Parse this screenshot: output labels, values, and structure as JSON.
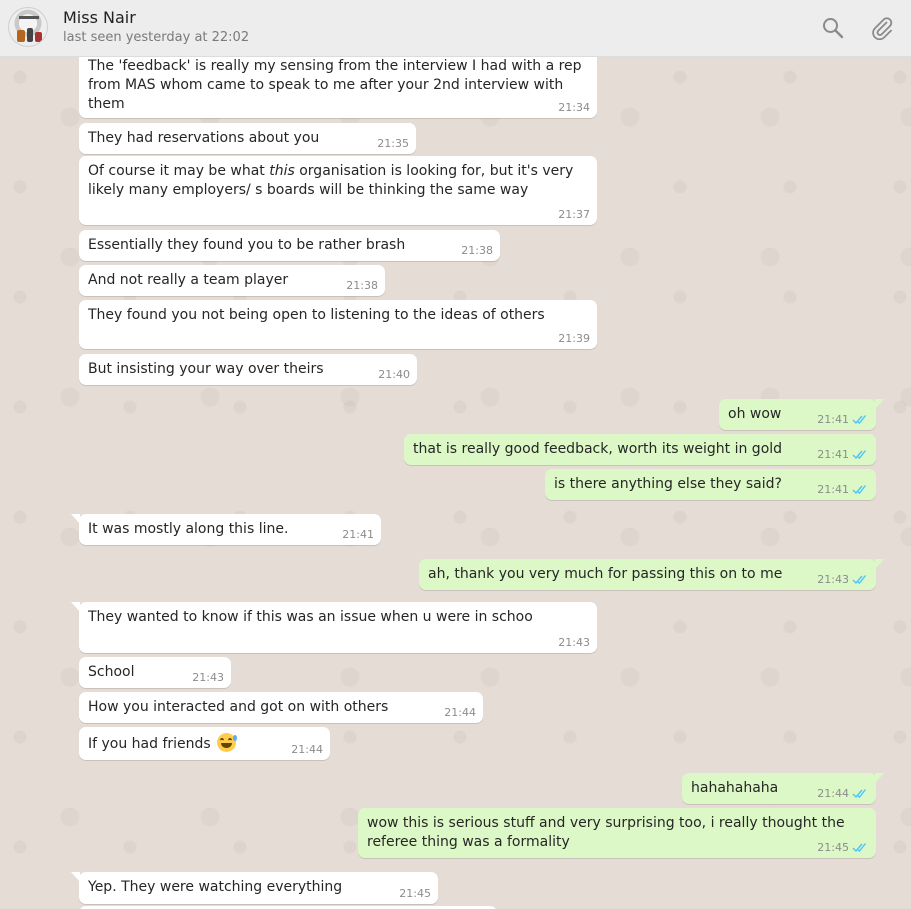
{
  "header": {
    "contact_name": "Miss Nair",
    "last_seen": "last seen yesterday at 22:02",
    "search_icon": "search-icon",
    "attach_icon": "paperclip-icon"
  },
  "colors": {
    "chat_background": "#e5ddd5",
    "incoming_bubble": "#ffffff",
    "outgoing_bubble": "#dcf8c6",
    "read_ticks": "#4fc3f7"
  },
  "messages": [
    {
      "dir": "in",
      "time": "21:34",
      "lines": [
        "The 'feedback' is really my sensing from the interview I had with a rep",
        "from MAS whom came to speak to me after your 2nd interview with",
        "them"
      ]
    },
    {
      "dir": "in",
      "time": "21:35",
      "lines": [
        "They had reservations about you"
      ]
    },
    {
      "dir": "in",
      "time": "21:37",
      "pre": "Of course it may be what ",
      "em": "this",
      "post": " organisation is looking for, but it's very",
      "line2": "likely many employers/ s boards will be thinking the same way"
    },
    {
      "dir": "in",
      "time": "21:38",
      "lines": [
        "Essentially they found you to be rather brash"
      ]
    },
    {
      "dir": "in",
      "time": "21:38",
      "lines": [
        "And not really a team player"
      ]
    },
    {
      "dir": "in",
      "time": "21:39",
      "lines": [
        "They found you not being open to listening to the ideas of others"
      ]
    },
    {
      "dir": "in",
      "time": "21:40",
      "lines": [
        "But insisting your way over theirs"
      ]
    },
    {
      "dir": "out",
      "time": "21:41",
      "status": "read",
      "lines": [
        "oh wow"
      ]
    },
    {
      "dir": "out",
      "time": "21:41",
      "status": "read",
      "lines": [
        "that is really good feedback, worth its weight in gold"
      ]
    },
    {
      "dir": "out",
      "time": "21:41",
      "status": "read",
      "lines": [
        "is there anything else they said?"
      ]
    },
    {
      "dir": "in",
      "time": "21:41",
      "lines": [
        "It was mostly along this line."
      ]
    },
    {
      "dir": "out",
      "time": "21:43",
      "status": "read",
      "lines": [
        "ah, thank you very much for passing this on to me"
      ]
    },
    {
      "dir": "in",
      "time": "21:43",
      "lines": [
        "They wanted to know if this was an issue when u were in schoo"
      ]
    },
    {
      "dir": "in",
      "time": "21:43",
      "lines": [
        "School"
      ]
    },
    {
      "dir": "in",
      "time": "21:44",
      "lines": [
        "How you interacted and got on with others"
      ]
    },
    {
      "dir": "in",
      "time": "21:44",
      "lines": [
        "If you had friends"
      ],
      "emoji": "grinning-sweat-emoji"
    },
    {
      "dir": "out",
      "time": "21:44",
      "status": "read",
      "lines": [
        "hahahahaha"
      ]
    },
    {
      "dir": "out",
      "time": "21:45",
      "status": "read",
      "lines": [
        "wow this is serious stuff and very surprising too, i really thought the",
        "referee thing was a formality"
      ]
    },
    {
      "dir": "in",
      "time": "21:45",
      "lines": [
        "Yep. They were watching everything"
      ]
    }
  ]
}
